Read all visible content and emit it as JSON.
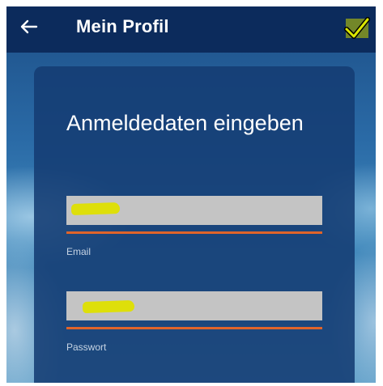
{
  "appbar": {
    "title": "Mein Profil",
    "back_icon": "arrow-left-icon",
    "confirm_icon": "checkmark-icon",
    "background": "#0c2b5c",
    "confirm_color": "#d8e000"
  },
  "card": {
    "heading": "Anmeldedaten eingeben",
    "background": "#143c73"
  },
  "form": {
    "email": {
      "label": "Email",
      "value_redacted": true,
      "underline_color": "#e0642a"
    },
    "password": {
      "label": "Passwort",
      "value_redacted": true,
      "underline_color": "#e0642a"
    }
  },
  "redaction_color": "#dfe000"
}
